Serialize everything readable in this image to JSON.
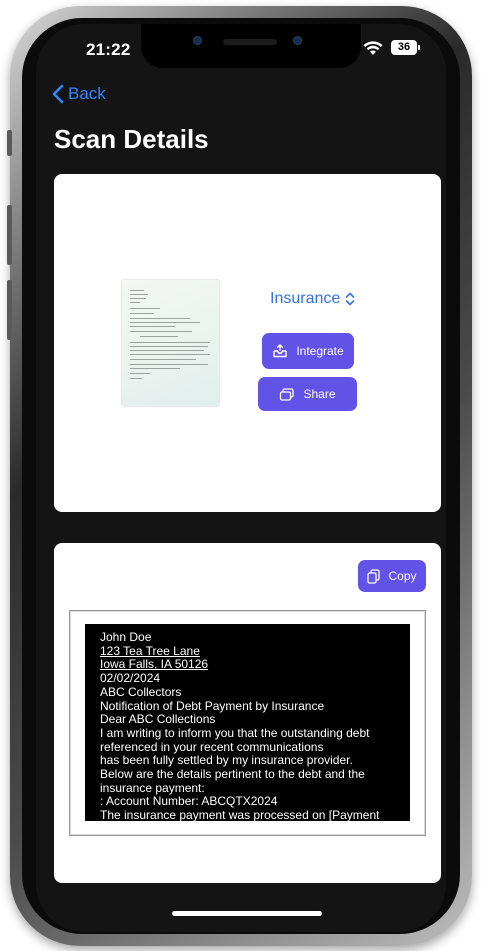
{
  "status": {
    "time": "21:22",
    "battery": "36"
  },
  "nav": {
    "back_label": "Back",
    "title": "Scan Details"
  },
  "scan": {
    "category": "Insurance",
    "integrate_label": "Integrate",
    "share_label": "Share"
  },
  "text_panel": {
    "copy_label": "Copy",
    "lines": [
      "John Doe",
      "123 Tea Tree Lane",
      "Iowa Falls, IA 50126",
      "02/02/2024",
      "ABC Collectors",
      "Notification of Debt Payment by Insurance",
      "Dear ABC Collections",
      "I am writing to inform you that the outstanding debt",
      "referenced in your recent communications",
      "has been fully settled by my insurance provider.",
      "Below are the details pertinent to the debt and the",
      "insurance payment:",
      ": Account Number: ABCQTX2024",
      "The insurance payment was processed on [Payment"
    ]
  },
  "colors": {
    "accent_blue": "#2f86ff",
    "button_purple": "#6152e8",
    "screen_bg": "#141414"
  },
  "icons": [
    "chevron-left-icon",
    "wifi-icon",
    "battery-icon",
    "up-down-chevron-icon",
    "tray-upload-icon",
    "share-icon",
    "copy-icon"
  ]
}
